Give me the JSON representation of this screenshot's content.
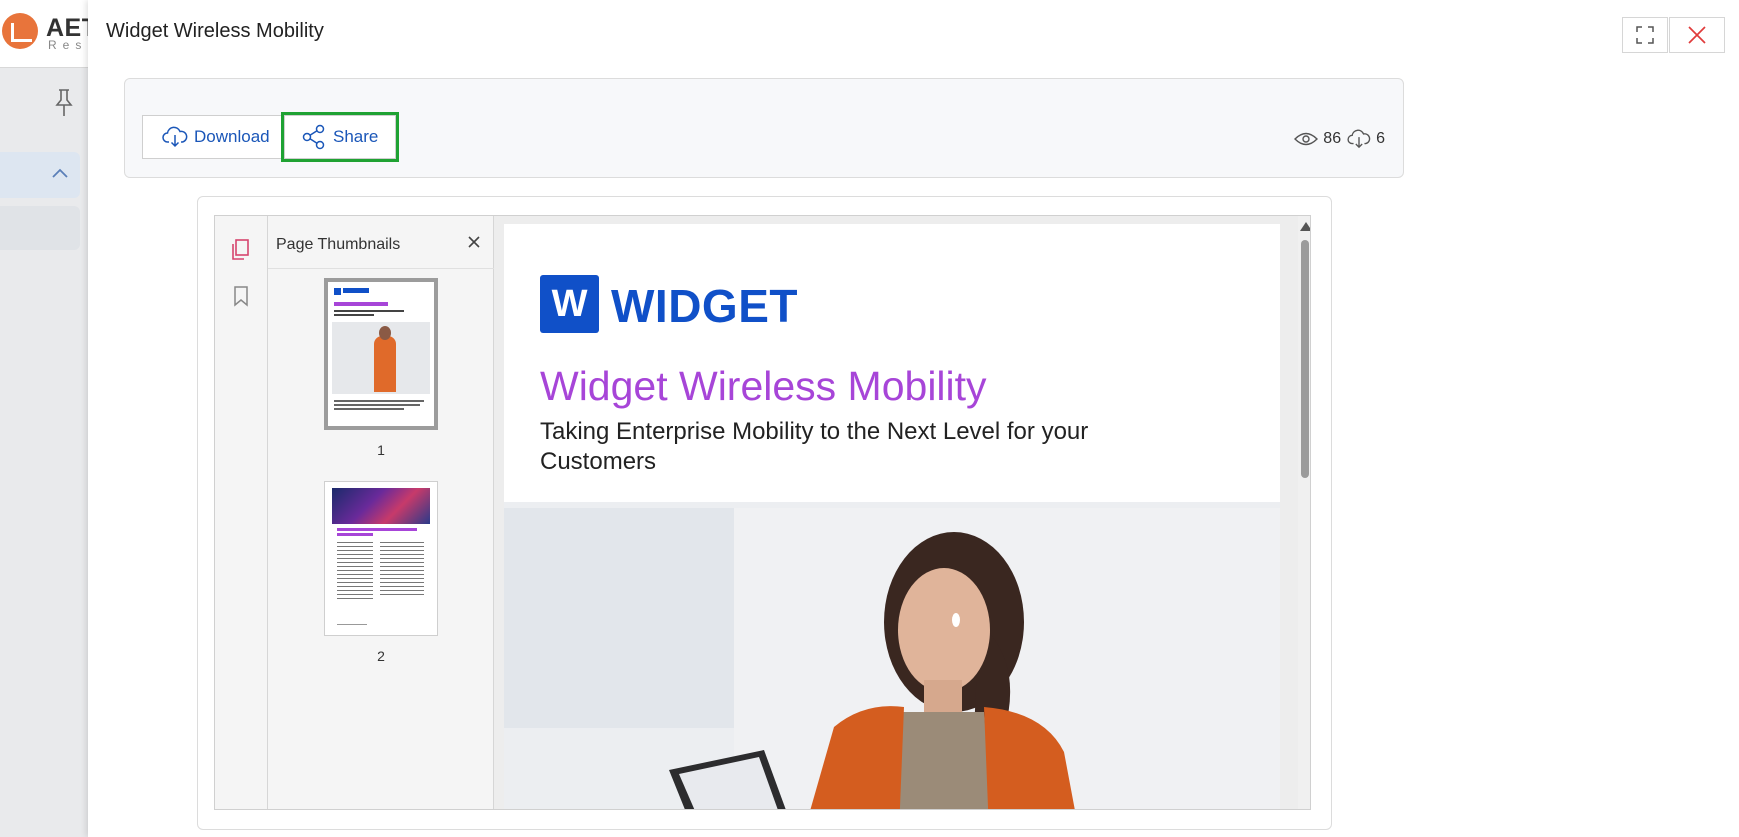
{
  "background_app": {
    "logo_text": "AET",
    "logo_sub": "Res"
  },
  "modal": {
    "title": "Widget Wireless Mobility",
    "actions": {
      "download_label": "Download",
      "share_label": "Share"
    },
    "stats": {
      "views": "86",
      "downloads": "6"
    }
  },
  "viewer": {
    "thumbnails_title": "Page Thumbnails",
    "thumbnails": [
      {
        "page": "1",
        "selected": true
      },
      {
        "page": "2",
        "selected": false
      }
    ],
    "page": {
      "logo_letter": "W",
      "logo_word": "WIDGET",
      "title": "Widget Wireless Mobility",
      "subtitle": "Taking Enterprise Mobility to the Next Level for your Customers"
    }
  },
  "colors": {
    "accent_blue": "#1a56b8",
    "brand_blue": "#1050c8",
    "title_purple": "#a745d8",
    "share_highlight": "#1fa233",
    "close_red": "#e03b3b"
  }
}
